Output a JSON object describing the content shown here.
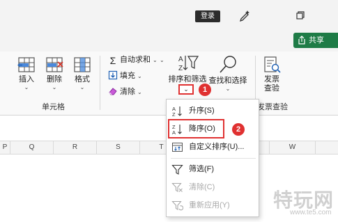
{
  "titlebar": {
    "login_label": "登录",
    "pen_icon": "pen-sparkle-icon",
    "restore_icon": "restore-window-icon"
  },
  "share": {
    "label": "共享",
    "icon": "share-icon"
  },
  "ribbon": {
    "cells_group": {
      "label": "单元格",
      "buttons": [
        {
          "label": "插入",
          "icon": "insert-cells-icon"
        },
        {
          "label": "删除",
          "icon": "delete-cells-icon"
        },
        {
          "label": "格式",
          "icon": "format-cells-icon"
        }
      ]
    },
    "editing_group": {
      "autosum_label": "自动求和",
      "fill_label": "填充",
      "clear_label": "清除",
      "sort_filter_label": "排序和筛选",
      "find_select_label": "查找和选择"
    },
    "invoice_group": {
      "button_label": "发票查验",
      "group_label": "发票查验"
    }
  },
  "badges": {
    "first": "1",
    "second": "2"
  },
  "columns": [
    "P",
    "Q",
    "R",
    "S",
    "T",
    "U",
    "V",
    "W"
  ],
  "sort_menu": {
    "items": [
      {
        "label": "升序(S)",
        "icon": "sort-ascending-icon",
        "enabled": true
      },
      {
        "label": "降序(O)",
        "icon": "sort-descending-icon",
        "enabled": true
      },
      {
        "label": "自定义排序(U)...",
        "icon": "custom-sort-icon",
        "enabled": true
      },
      {
        "label": "筛选(F)",
        "icon": "filter-icon",
        "enabled": true
      },
      {
        "label": "清除(C)",
        "icon": "clear-filter-icon",
        "enabled": false
      },
      {
        "label": "重新应用(Y)",
        "icon": "reapply-icon",
        "enabled": false
      }
    ]
  },
  "watermark": {
    "text": "特玩网",
    "url": "www.te5.com"
  },
  "colors": {
    "accent_red": "#e03131",
    "share_green": "#1e7b46"
  }
}
